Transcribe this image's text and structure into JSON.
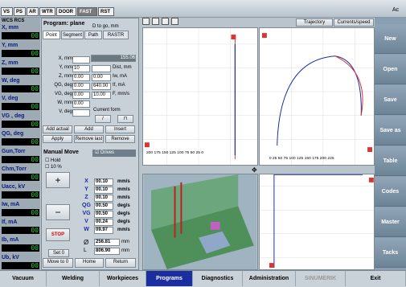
{
  "modes": [
    "VS",
    "PS",
    "AR",
    "WTR",
    "DOOR",
    "FAST",
    "RST"
  ],
  "corner_label": "Ac",
  "left": [
    {
      "label": "X, mm",
      "value": "00"
    },
    {
      "label": "Y, mm",
      "value": "00"
    },
    {
      "label": "Z, mm",
      "value": "00"
    },
    {
      "label": "W, deg",
      "value": "00"
    },
    {
      "label": "V, deg",
      "value": "00"
    },
    {
      "label": "VG , deg",
      "value": "00"
    },
    {
      "label": "QG, deg",
      "value": "00"
    },
    {
      "label": "Gun,Torr",
      "value": "00"
    },
    {
      "label": "Chm,Torr",
      "value": "00"
    },
    {
      "label": "Uacc, kV",
      "value": "00"
    },
    {
      "label": "Iw, mA",
      "value": "00"
    },
    {
      "label": "If, mA",
      "value": "00"
    },
    {
      "label": "Ib, mA",
      "value": "00"
    },
    {
      "label": "Ub, kV",
      "value": "00"
    }
  ],
  "wcs_tabs": [
    "WCS",
    "RCS"
  ],
  "program": {
    "label": "Program: plane",
    "tabs": [
      "Point",
      "Segment",
      "Path",
      "RASTR"
    ],
    "header": "D to go, mm",
    "d_to_go": "155.06",
    "fields": [
      {
        "l": "X, mm",
        "v": ""
      },
      {
        "l": "Y, mm",
        "v": "10"
      },
      {
        "l": "Z, mm",
        "v": "0.00"
      },
      {
        "l": "QG, deg",
        "v": "0.00"
      },
      {
        "l": "VG, deg",
        "v": "0.00"
      },
      {
        "l": "W, mm",
        "v": "0.00"
      },
      {
        "l": "V, deg",
        "v": ""
      }
    ],
    "rfields": [
      {
        "l": "Dist, mm",
        "v": ""
      },
      {
        "l": "Iw, mA",
        "v": "0.00"
      },
      {
        "l": "If, mA",
        "v": "640.00"
      },
      {
        "l": "F, mm/s",
        "v": "10.00"
      }
    ],
    "current_form": "Current form",
    "buttons": [
      "Add actual",
      "Add",
      "Insert",
      "Apply",
      "Remove last",
      "Remove"
    ],
    "manual": "Manual Move",
    "drives": "Drives",
    "hold": "Hold",
    "pct": "10 %",
    "axes": [
      {
        "a": "X",
        "v": "00.10",
        "u": "mm/s"
      },
      {
        "a": "Y",
        "v": "00.10",
        "u": "mm/s"
      },
      {
        "a": "Z",
        "v": "00.10",
        "u": "mm/s"
      },
      {
        "a": "QG",
        "v": "00.50",
        "u": "deg/s"
      },
      {
        "a": "VG",
        "v": "00.50",
        "u": "deg/s"
      },
      {
        "a": "V",
        "v": "00.24",
        "u": "deg/s"
      },
      {
        "a": "W",
        "v": "09.97",
        "u": "mm/s"
      }
    ],
    "diam": "256.81",
    "diam_u": "mm",
    "len": "806.90",
    "len_u": "mm",
    "stop": "STOP",
    "set0": "Set 0",
    "move0": "Move to 0",
    "home": "Home",
    "ret": "Return"
  },
  "plot_tabs": [
    "Trajectory",
    "Currents/speed"
  ],
  "side": [
    "New",
    "Open",
    "Save",
    "Save as",
    "Table",
    "Codes",
    "Master",
    "Tacks"
  ],
  "bottom": [
    "Vacuum",
    "Welding",
    "Workpieces",
    "Programs",
    "Diagnostics",
    "Administration",
    "SINUMERIK",
    "Exit"
  ],
  "colors": {
    "accent": "#1a2ea0",
    "active": "#1a2ea0"
  }
}
